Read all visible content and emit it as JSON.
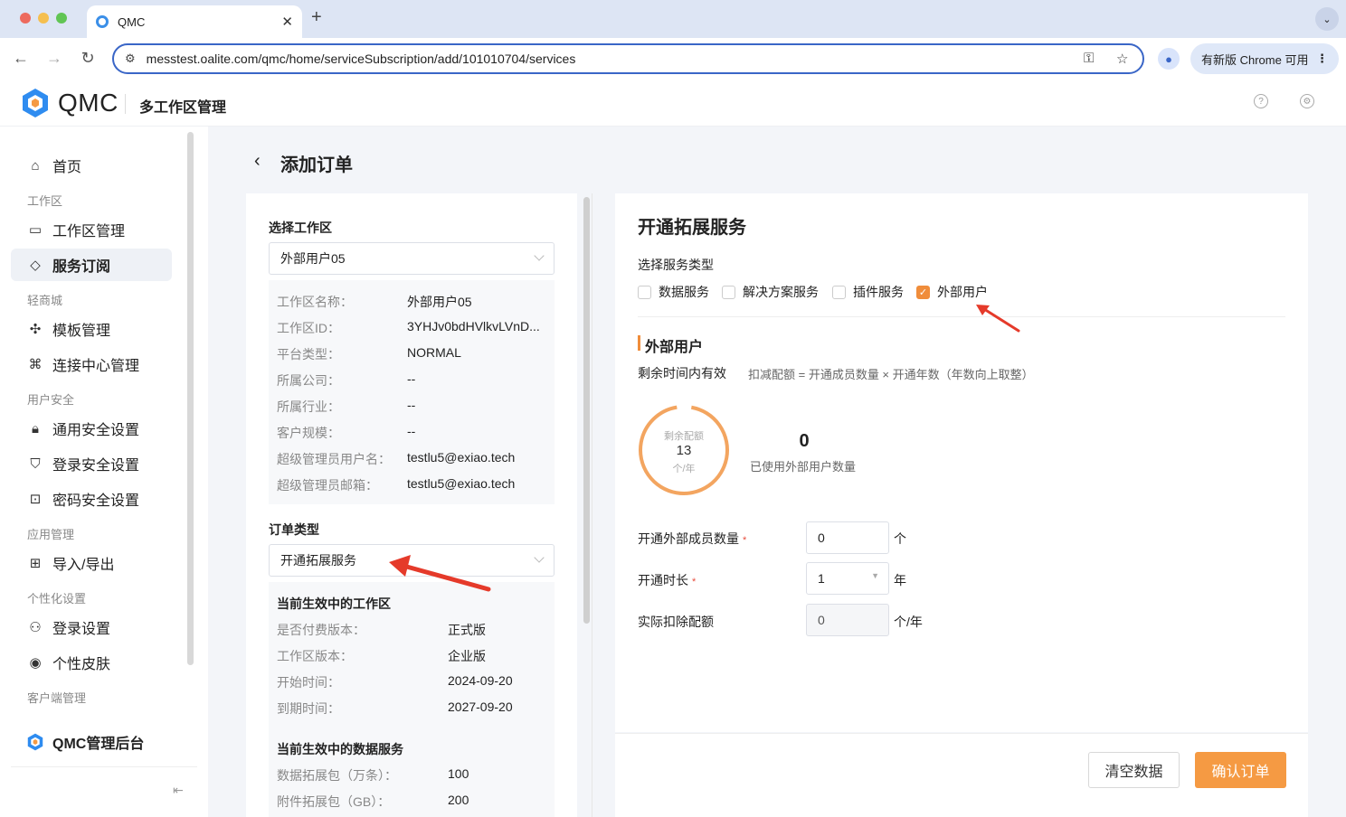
{
  "browser": {
    "tab_title": "QMC",
    "url": "messtest.oalite.com/qmc/home/serviceSubscription/add/101010704/services",
    "update_button": "有新版 Chrome 可用"
  },
  "app": {
    "logo_text": "QMC",
    "header_title": "多工作区管理"
  },
  "sidebar": {
    "home": "首页",
    "group_workspace": "工作区",
    "workspace_mgmt": "工作区管理",
    "service_sub": "服务订阅",
    "group_mall": "轻商城",
    "template_mgmt": "模板管理",
    "connect_center": "连接中心管理",
    "group_user_security": "用户安全",
    "general_security": "通用安全设置",
    "login_security": "登录安全设置",
    "password_security": "密码安全设置",
    "group_app_mgmt": "应用管理",
    "import_export": "导入/导出",
    "group_personalize": "个性化设置",
    "login_settings": "登录设置",
    "skin": "个性皮肤",
    "group_client": "客户端管理",
    "footer": "QMC管理后台"
  },
  "page": {
    "title": "添加订单"
  },
  "left": {
    "select_workspace_label": "选择工作区",
    "select_workspace_value": "外部用户05",
    "info": [
      {
        "k": "工作区名称：",
        "v": "外部用户05"
      },
      {
        "k": "工作区ID：",
        "v": "3YHJv0bdHVlkvLVnD..."
      },
      {
        "k": "平台类型：",
        "v": "NORMAL"
      },
      {
        "k": "所属公司：",
        "v": "--"
      },
      {
        "k": "所属行业：",
        "v": "--"
      },
      {
        "k": "客户规模：",
        "v": "--"
      },
      {
        "k": "超级管理员用户名：",
        "v": "testlu5@exiao.tech"
      },
      {
        "k": "超级管理员邮箱：",
        "v": "testlu5@exiao.tech"
      }
    ],
    "order_type_label": "订单类型",
    "order_type_value": "开通拓展服务",
    "current_ws_title": "当前生效中的工作区",
    "current_ws": [
      {
        "k": "是否付费版本：",
        "v": "正式版"
      },
      {
        "k": "工作区版本：",
        "v": "企业版"
      },
      {
        "k": "开始时间：",
        "v": "2024-09-20"
      },
      {
        "k": "到期时间：",
        "v": "2027-09-20"
      }
    ],
    "current_data_title": "当前生效中的数据服务",
    "current_data": [
      {
        "k": "数据拓展包（万条）：",
        "v": "100"
      },
      {
        "k": "附件拓展包（GB）：",
        "v": "200"
      }
    ]
  },
  "right": {
    "title": "开通拓展服务",
    "service_type_label": "选择服务类型",
    "checkboxes": [
      {
        "label": "数据服务",
        "checked": false
      },
      {
        "label": "解决方案服务",
        "checked": false
      },
      {
        "label": "插件服务",
        "checked": false
      },
      {
        "label": "外部用户",
        "checked": true
      }
    ],
    "section_title": "外部用户",
    "validity": "剩余时间内有效",
    "formula": "扣减配额 = 开通成员数量 × 开通年数（年数向上取整）",
    "ring_label": "剩余配额",
    "ring_value": "13",
    "ring_unit": "个/年",
    "used_value": "0",
    "used_label": "已使用外部用户数量",
    "form": {
      "members_label": "开通外部成员数量",
      "members_value": "0",
      "members_unit": "个",
      "duration_label": "开通时长",
      "duration_value": "1",
      "duration_unit": "年",
      "deduct_label": "实际扣除配额",
      "deduct_value": "0",
      "deduct_unit": "个/年",
      "required_mark": "*"
    },
    "btn_clear": "清空数据",
    "btn_confirm": "确认订单"
  },
  "colors": {
    "accent": "#f59a43",
    "annotation_arrow": "#e53a2a",
    "link_blue": "#3a66c7"
  }
}
